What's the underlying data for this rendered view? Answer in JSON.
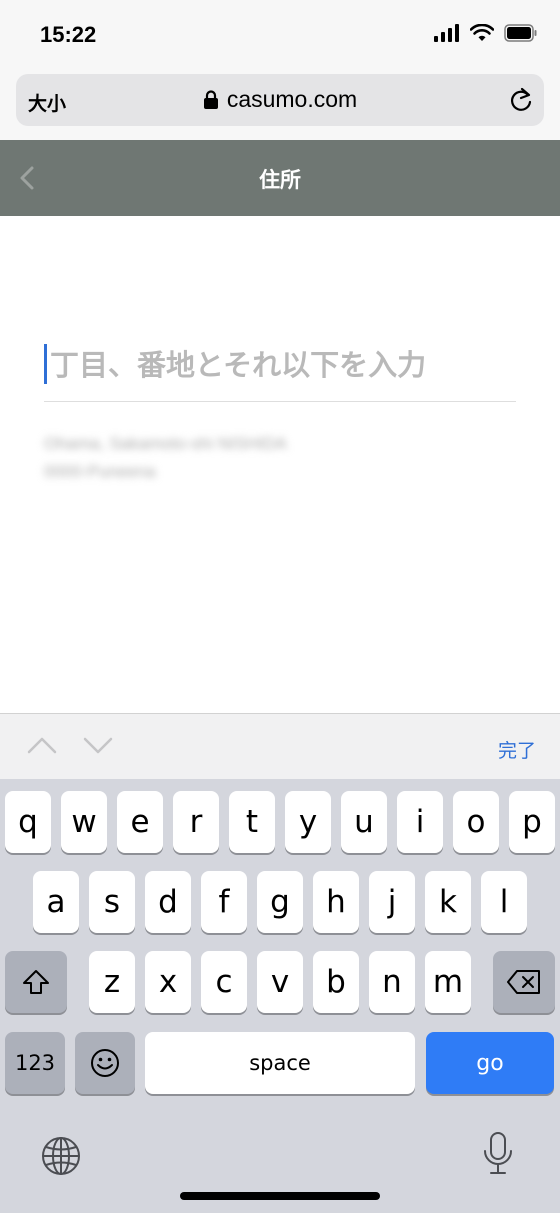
{
  "status_bar": {
    "time": "15:22"
  },
  "browser": {
    "text_size_label": "大小",
    "url": "casumo.com"
  },
  "header": {
    "title": "住所"
  },
  "form": {
    "address_line_placeholder": "丁目、番地とそれ以下を入力",
    "address_line_value": "",
    "hint_line_1": "Ohama, Sakamoto-shi NISHIDA",
    "hint_line_2": "0000-Puneena"
  },
  "accessory": {
    "done_label": "完了"
  },
  "keyboard": {
    "row1": [
      "q",
      "w",
      "e",
      "r",
      "t",
      "y",
      "u",
      "i",
      "o",
      "p"
    ],
    "row2": [
      "a",
      "s",
      "d",
      "f",
      "g",
      "h",
      "j",
      "k",
      "l"
    ],
    "row3": [
      "z",
      "x",
      "c",
      "v",
      "b",
      "n",
      "m"
    ],
    "numbers_label": "123",
    "space_label": "space",
    "go_label": "go"
  },
  "colors": {
    "header_bg": "#6f7773",
    "accent": "#2f6fd6",
    "go_key": "#2f7cf6",
    "keyboard_bg": "#d4d6dd"
  }
}
